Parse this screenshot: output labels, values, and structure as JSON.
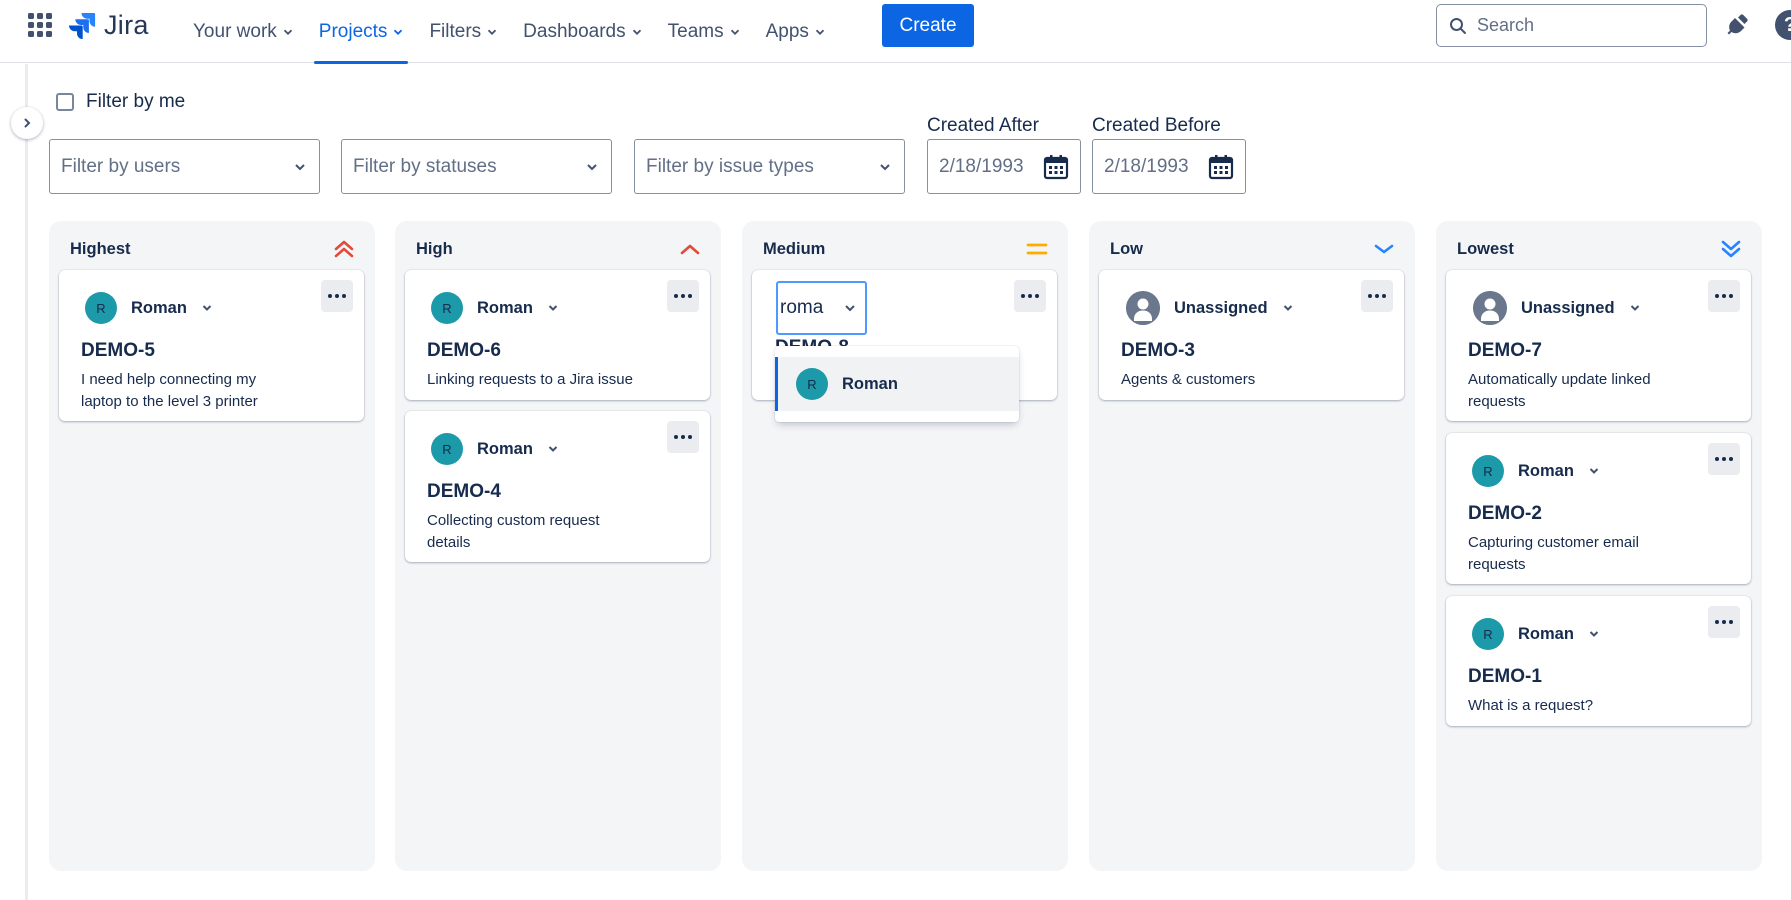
{
  "app": {
    "logo_text": "Jira"
  },
  "nav": {
    "items": [
      {
        "label": "Your work",
        "active": false
      },
      {
        "label": "Projects",
        "active": true
      },
      {
        "label": "Filters",
        "active": false
      },
      {
        "label": "Dashboards",
        "active": false
      },
      {
        "label": "Teams",
        "active": false
      },
      {
        "label": "Apps",
        "active": false
      }
    ],
    "create_label": "Create",
    "search_placeholder": "Search",
    "help_label": "?"
  },
  "filters": {
    "filter_by_me": "Filter by me",
    "users_placeholder": "Filter by users",
    "statuses_placeholder": "Filter by statuses",
    "issue_types_placeholder": "Filter by issue types",
    "created_after_label": "Created After",
    "created_after_value": "2/18/1993",
    "created_before_label": "Created Before",
    "created_before_value": "2/18/1993"
  },
  "columns": [
    {
      "title": "Highest",
      "priority_icon": "priority-highest-icon",
      "icon_color": "#e5493a",
      "cards": [
        {
          "assignee": "Roman",
          "avatar_initial": "R",
          "key": "DEMO-5",
          "summary": "I need help connecting my laptop to the level 3 printer"
        }
      ]
    },
    {
      "title": "High",
      "priority_icon": "priority-high-icon",
      "icon_color": "#e5493a",
      "cards": [
        {
          "assignee": "Roman",
          "avatar_initial": "R",
          "key": "DEMO-6",
          "summary": "Linking requests to a Jira issue"
        },
        {
          "assignee": "Roman",
          "avatar_initial": "R",
          "key": "DEMO-4",
          "summary": "Collecting custom request details"
        }
      ]
    },
    {
      "title": "Medium",
      "priority_icon": "priority-medium-icon",
      "icon_color": "#ffab00",
      "cards": [
        {
          "assignee_search_value": "roma",
          "key_partial": "DEMO-8"
        }
      ]
    },
    {
      "title": "Low",
      "priority_icon": "priority-low-icon",
      "icon_color": "#2684ff",
      "cards": [
        {
          "assignee": "Unassigned",
          "avatar_initial": "",
          "key": "DEMO-3",
          "summary": "Agents & customers"
        }
      ]
    },
    {
      "title": "Lowest",
      "priority_icon": "priority-lowest-icon",
      "icon_color": "#2684ff",
      "cards": [
        {
          "assignee": "Unassigned",
          "avatar_initial": "",
          "key": "DEMO-7",
          "summary": "Automatically update linked requests"
        },
        {
          "assignee": "Roman",
          "avatar_initial": "R",
          "key": "DEMO-2",
          "summary": "Capturing customer email requests"
        },
        {
          "assignee": "Roman",
          "avatar_initial": "R",
          "key": "DEMO-1",
          "summary": "What is a request?"
        }
      ]
    }
  ],
  "assignee_menu": {
    "options": [
      {
        "name": "Roman",
        "avatar_initial": "R",
        "highlighted": true
      }
    ]
  },
  "colors": {
    "accent": "#0c66e4",
    "avatar": "#1d9aaa",
    "column_bg": "#f4f5f7"
  }
}
